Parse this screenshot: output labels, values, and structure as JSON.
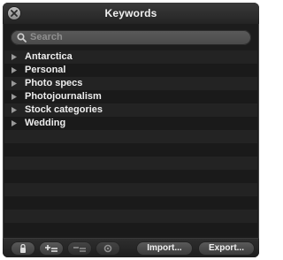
{
  "window": {
    "title": "Keywords",
    "close_icon": "close-icon"
  },
  "search": {
    "placeholder": "Search",
    "icon": "search-icon"
  },
  "keywords": [
    {
      "label": "Antarctica"
    },
    {
      "label": "Personal"
    },
    {
      "label": "Photo specs"
    },
    {
      "label": "Photojournalism"
    },
    {
      "label": "Stock categories"
    },
    {
      "label": "Wedding"
    }
  ],
  "toolbar": {
    "buttons": [
      {
        "icon": "lock-icon",
        "enabled": true
      },
      {
        "icon": "add-keyword-icon",
        "enabled": true
      },
      {
        "icon": "remove-keyword-icon",
        "enabled": false
      },
      {
        "icon": "gear-icon",
        "enabled": false
      }
    ],
    "import_label": "Import...",
    "export_label": "Export..."
  },
  "colors": {
    "panel_bg": "#1c1c1c",
    "row_light": "#232323",
    "row_dark": "#1a1a1a",
    "text": "#eeeeee"
  }
}
